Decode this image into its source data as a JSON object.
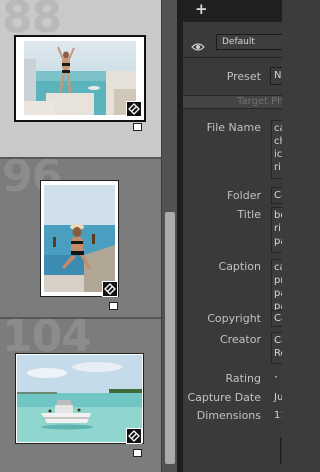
{
  "filmstrip": {
    "cells": [
      {
        "number": "88",
        "selected": true
      },
      {
        "number": "96",
        "selected": false
      },
      {
        "number": "104",
        "selected": false
      }
    ]
  },
  "toolbar": {
    "add_icon": "plus-icon",
    "visibility_icon": "eye-icon"
  },
  "metadata": {
    "preset_menu_value": "Default",
    "preset_label": "Preset",
    "preset_value": "N",
    "target_text": "Target Ph",
    "fields": {
      "file_name": {
        "label": "File Name",
        "lines": [
          "ca",
          "ch",
          "ic",
          "ri"
        ]
      },
      "folder": {
        "label": "Folder",
        "lines": [
          "Ca"
        ]
      },
      "title": {
        "label": "Title",
        "lines": [
          "be",
          "ri",
          "pa"
        ]
      },
      "caption": {
        "label": "Caption",
        "lines": [
          "ca",
          "pr",
          "pa",
          "pa"
        ]
      },
      "copyright": {
        "label": "Copyright",
        "lines": [
          "Ca"
        ]
      },
      "creator": {
        "label": "Creator",
        "lines": [
          "Ca",
          "Ro"
        ]
      },
      "rating": {
        "label": "Rating",
        "value": "·"
      },
      "capture_date": {
        "label": "Capture Date",
        "value": "Ju"
      },
      "dimensions": {
        "label": "Dimensions",
        "value": "11"
      }
    }
  },
  "colors": {
    "filmstrip_bg": "#7b7b7b",
    "selected_cell_bg": "#c9c9c9",
    "panel_bg": "#3a3a3a"
  }
}
